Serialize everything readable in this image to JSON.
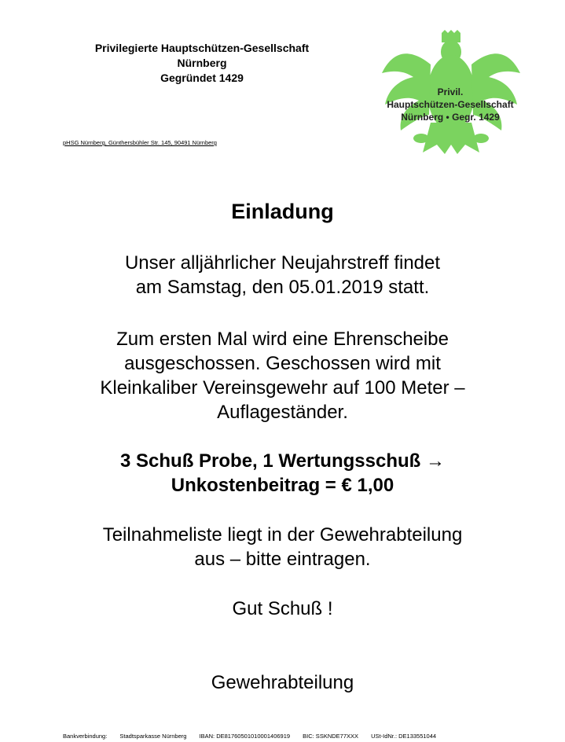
{
  "header": {
    "org_line1": "Privilegierte Hauptschützen-Gesellschaft",
    "org_line2": "Nürnberg",
    "org_line3": "Gegründet 1429",
    "address": "pHSG Nürnberg, Günthersbühler Str. 145, 90491 Nürnberg"
  },
  "logo": {
    "icon": "eagle-crest-icon",
    "color": "#7bd35f",
    "line1": "Privil.",
    "line2": "Hauptschützen-Gesellschaft",
    "line3": "Nürnberg  •  Gegr. 1429"
  },
  "main": {
    "title": "Einladung",
    "para1": [
      "Unser alljährlicher Neujahrstreff findet",
      "am Samstag, den 05.01.2019 statt."
    ],
    "para2": [
      "Zum ersten Mal wird eine Ehrenscheibe",
      "ausgeschossen. Geschossen wird mit",
      "Kleinkaliber Vereinsgewehr auf 100 Meter –",
      "Auflageständer."
    ],
    "para3": [
      "3 Schuß Probe, 1 Wertungsschuß  →",
      "Unkostenbeitrag = € 1,00"
    ],
    "para4": [
      "Teilnahmeliste liegt in der Gewehrabteilung",
      "aus – bitte eintragen."
    ],
    "closing": "Gut Schuß !",
    "signature": "Gewehrabteilung"
  },
  "footer": {
    "bank_label": "Bankverbindung:",
    "bank": "Stadtsparkasse Nürnberg",
    "iban": "IBAN: DE81760501010001406919",
    "bic": "BIC:  SSKNDE77XXX",
    "ust": "USt-IdNr.: DE133551044"
  }
}
